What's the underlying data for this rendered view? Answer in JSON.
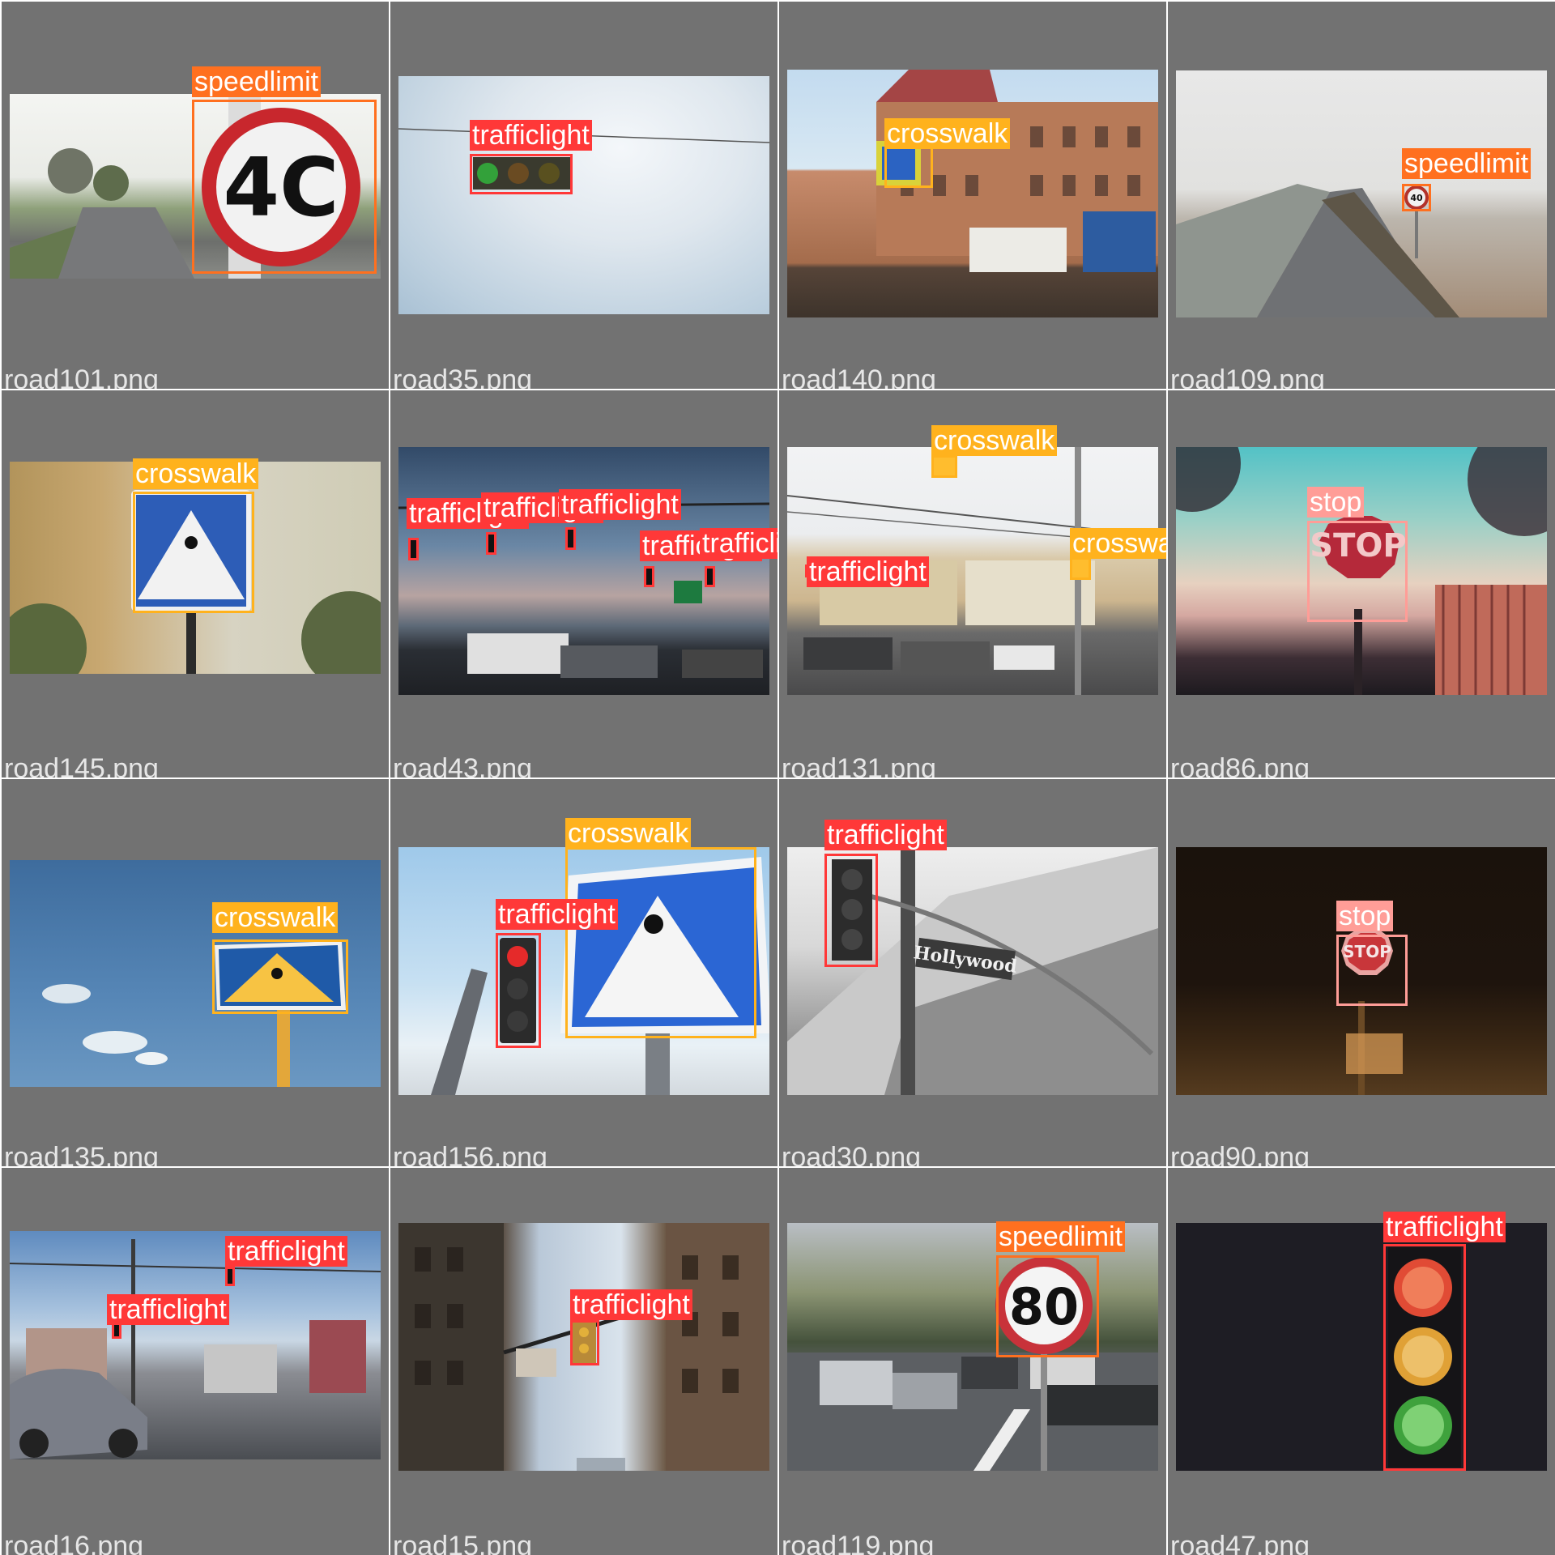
{
  "labels": {
    "speedlimit": "speedlimit",
    "crosswalk": "crosswalk",
    "trafficlight": "trafficlight",
    "stop": "stop"
  },
  "sign_text": {
    "speed_40": "4C",
    "speed_40_small": "40",
    "speed_80": "80",
    "stop": "STOP",
    "street": "Hollywood"
  },
  "filenames": [
    "road101.png",
    "road35.png",
    "road140.png",
    "road109.png",
    "road145.png",
    "road43.png",
    "road131.png",
    "road86.png",
    "road135.png",
    "road156.png",
    "road30.png",
    "road90.png",
    "road16.png",
    "road15.png",
    "road119.png",
    "road47.png"
  ],
  "colors": {
    "speedlimit": "#ff701f",
    "crosswalk": "#ffb21d",
    "trafficlight": "#ff3838",
    "stop": "#ff9d97",
    "tile_background": "#727272"
  }
}
